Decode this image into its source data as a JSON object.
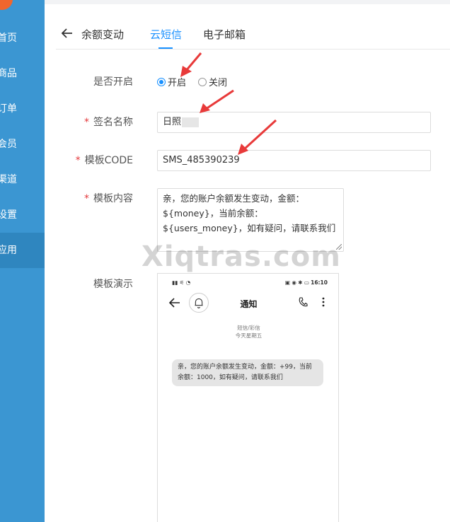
{
  "sidebar": {
    "items": [
      {
        "label": "首页"
      },
      {
        "label": "商品"
      },
      {
        "label": "订单"
      },
      {
        "label": "会员"
      },
      {
        "label": "渠道"
      },
      {
        "label": "设置"
      },
      {
        "label": "应用"
      }
    ],
    "active_index": 6
  },
  "header": {
    "title": "余额变动",
    "tabs": [
      {
        "label": "云短信",
        "active": true
      },
      {
        "label": "电子邮箱",
        "active": false
      }
    ]
  },
  "form": {
    "enable_label": "是否开启",
    "enable_options": [
      {
        "label": "开启",
        "checked": true
      },
      {
        "label": "关闭",
        "checked": false
      }
    ],
    "signature": {
      "label": "签名名称",
      "value": "日照"
    },
    "template_code": {
      "label": "模板CODE",
      "value": "SMS_485390239"
    },
    "template_content": {
      "label": "模板内容",
      "value": "亲，您的账户余额发生变动，金额：${money}，当前余额：${users_money}，如有疑问，请联系我们"
    },
    "preview_label": "模板演示"
  },
  "phone_preview": {
    "time": "16:10",
    "title": "通知",
    "channel": "短信/彩信",
    "date": "今天星期五",
    "message": "亲，您的账户余额发生变动，金额：+99，当前余额：1000，如有疑问，请联系我们"
  },
  "watermark": "Xiqtras.com",
  "colors": {
    "sidebar": "#3b96d2",
    "accent": "#1890ff",
    "required": "#e4393c",
    "arrow": "#e83a3a"
  }
}
